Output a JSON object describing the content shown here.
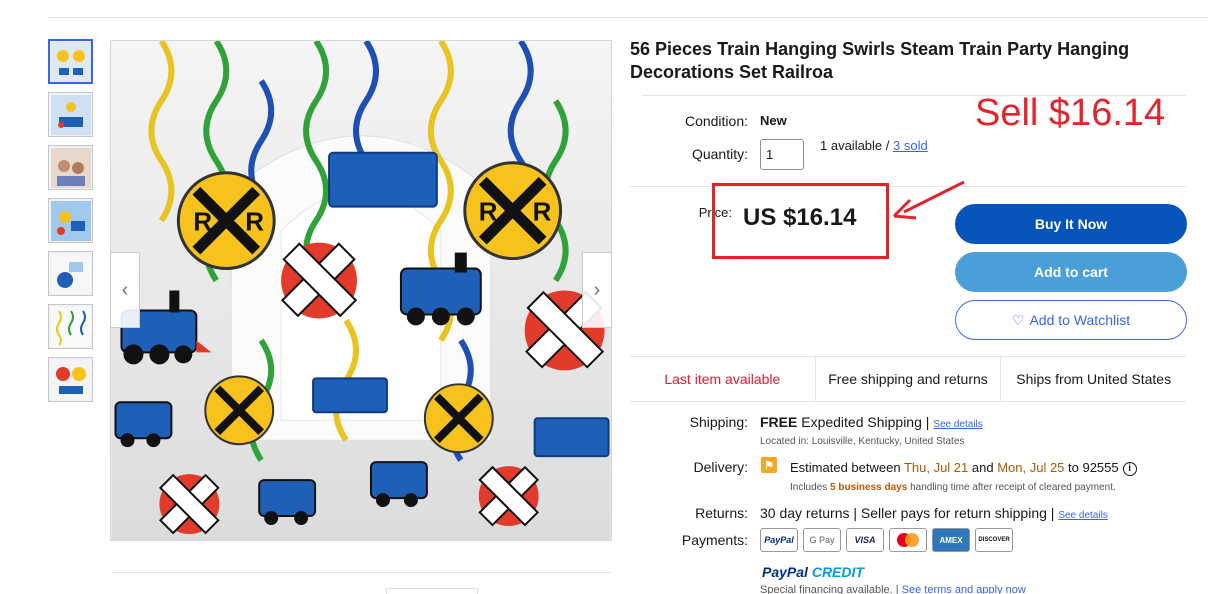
{
  "product": {
    "title": "56 Pieces Train Hanging Swirls Steam Train Party Hanging Decorations Set Railroa"
  },
  "annotation": {
    "sell_note": "Sell $16.14"
  },
  "details": {
    "condition_label": "Condition:",
    "condition_value": "New",
    "quantity_label": "Quantity:",
    "quantity_value": "1",
    "available_text": "1 available / ",
    "sold_text": "3 sold",
    "price_label": "Price:",
    "price_value": "US $16.14"
  },
  "buttons": {
    "buy_now": "Buy It Now",
    "add_to_cart": "Add to cart",
    "watchlist": "Add to Watchlist"
  },
  "features": [
    "Last item available",
    "Free shipping and returns",
    "Ships from United States"
  ],
  "shipping": {
    "label": "Shipping:",
    "free": "FREE",
    "method": " Expedited Shipping | ",
    "see_details": "See details",
    "location": "Located in: Louisville, Kentucky, United States"
  },
  "delivery": {
    "label": "Delivery:",
    "text_prefix": "Estimated between ",
    "date1": "Thu, Jul 21",
    "and": " and ",
    "date2": "Mon, Jul 25",
    "to": " to 92555",
    "note_prefix": "Includes ",
    "business_days": "5 business days",
    "note_suffix": " handling time after receipt of cleared payment."
  },
  "returns": {
    "label": "Returns:",
    "text": "30 day returns | Seller pays for return shipping | ",
    "see_details": "See details"
  },
  "payments": {
    "label": "Payments:",
    "methods": [
      "PayPal",
      "G Pay",
      "VISA",
      "MC",
      "AMEX",
      "DISCOVER"
    ],
    "paypal": "PayPal",
    "credit": "CREDIT",
    "special": "Special financing available. | ",
    "terms": "See terms and apply now"
  },
  "gallery": {
    "thumb_count": 7
  },
  "colors": {
    "accent": "#0654ba",
    "cart": "#4b9fd8",
    "annotation_red": "#e4242b",
    "link": "#3665f3"
  }
}
